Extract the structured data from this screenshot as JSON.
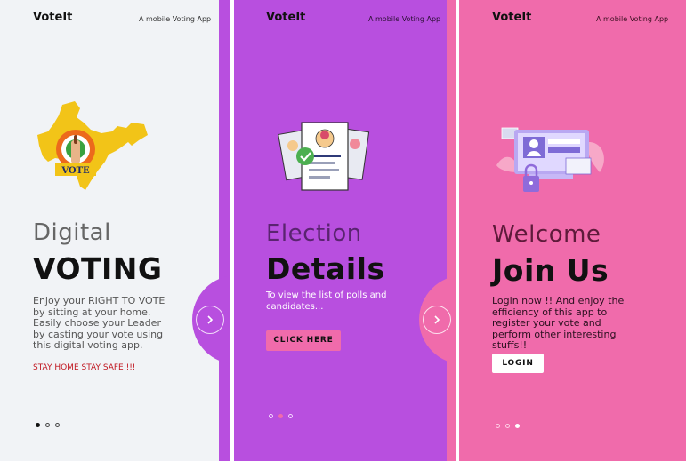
{
  "screens": [
    {
      "brand": "VoteIt",
      "tagline": "A mobile Voting App",
      "illustration_icon": "india-map-vote-icon",
      "illustration_text": "VOTE",
      "title_light": "Digital",
      "title_bold": "VOTING",
      "description": "Enjoy your RIGHT TO VOTE by sitting at your home. Easily choose your Leader by casting your vote using this digital voting app.",
      "slogan": "STAY HOME STAY SAFE !!!",
      "next_icon": "chevron-right-icon",
      "active_dot": 0
    },
    {
      "brand": "VoteIt",
      "tagline": "A mobile Voting App",
      "illustration_icon": "candidate-documents-icon",
      "title_light": "Election",
      "title_bold": "Details",
      "description": "To view the list of polls and candidates...",
      "button_label": "CLICK HERE",
      "next_icon": "chevron-right-icon",
      "active_dot": 1
    },
    {
      "brand": "VoteIt",
      "tagline": "A mobile Voting App",
      "illustration_icon": "login-screen-lock-icon",
      "title_light": "Welcome",
      "title_bold": "Join Us",
      "description": "Login now !! And enjoy the efficiency of this app to register your vote and perform other interesting stuffs!!",
      "button_label": "LOGIN",
      "active_dot": 2
    }
  ],
  "colors": {
    "screen1_bg": "#f1f3f6",
    "screen2_bg": "#b84fdf",
    "screen3_bg": "#f06bab",
    "slogan_red": "#c0151f",
    "button_pink": "#f06bab"
  }
}
